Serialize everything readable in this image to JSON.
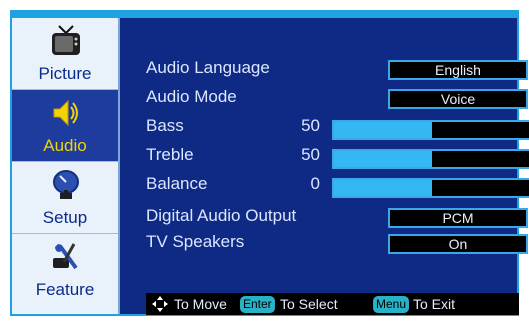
{
  "sidebar": {
    "items": [
      {
        "label": "Picture",
        "icon": "tv-icon"
      },
      {
        "label": "Audio",
        "icon": "speaker-icon",
        "active": true
      },
      {
        "label": "Setup",
        "icon": "satellite-dish-icon"
      },
      {
        "label": "Feature",
        "icon": "wrench-screwdriver-icon"
      }
    ]
  },
  "audio": {
    "audio_language": {
      "label": "Audio Language",
      "value": "English"
    },
    "audio_mode": {
      "label": "Audio Mode",
      "value": "Voice"
    },
    "bass": {
      "label": "Bass",
      "value": "50",
      "level": 0.5
    },
    "treble": {
      "label": "Treble",
      "value": "50",
      "level": 0.5
    },
    "balance": {
      "label": "Balance",
      "value": "0",
      "level": 0.5
    },
    "digital_audio_output": {
      "label": "Digital Audio Output",
      "value": "PCM"
    },
    "tv_speakers": {
      "label": "TV Speakers",
      "value": "On"
    }
  },
  "footer": {
    "move_label": "To Move",
    "enter_key": "Enter",
    "select_label": "To Select",
    "menu_key": "Menu",
    "exit_label": "To Exit"
  },
  "colors": {
    "panel_bg": "#0e2a84",
    "sidebar_bg": "#e9f1fa",
    "accent": "#1ea3e0",
    "active_label": "#f2d400"
  }
}
